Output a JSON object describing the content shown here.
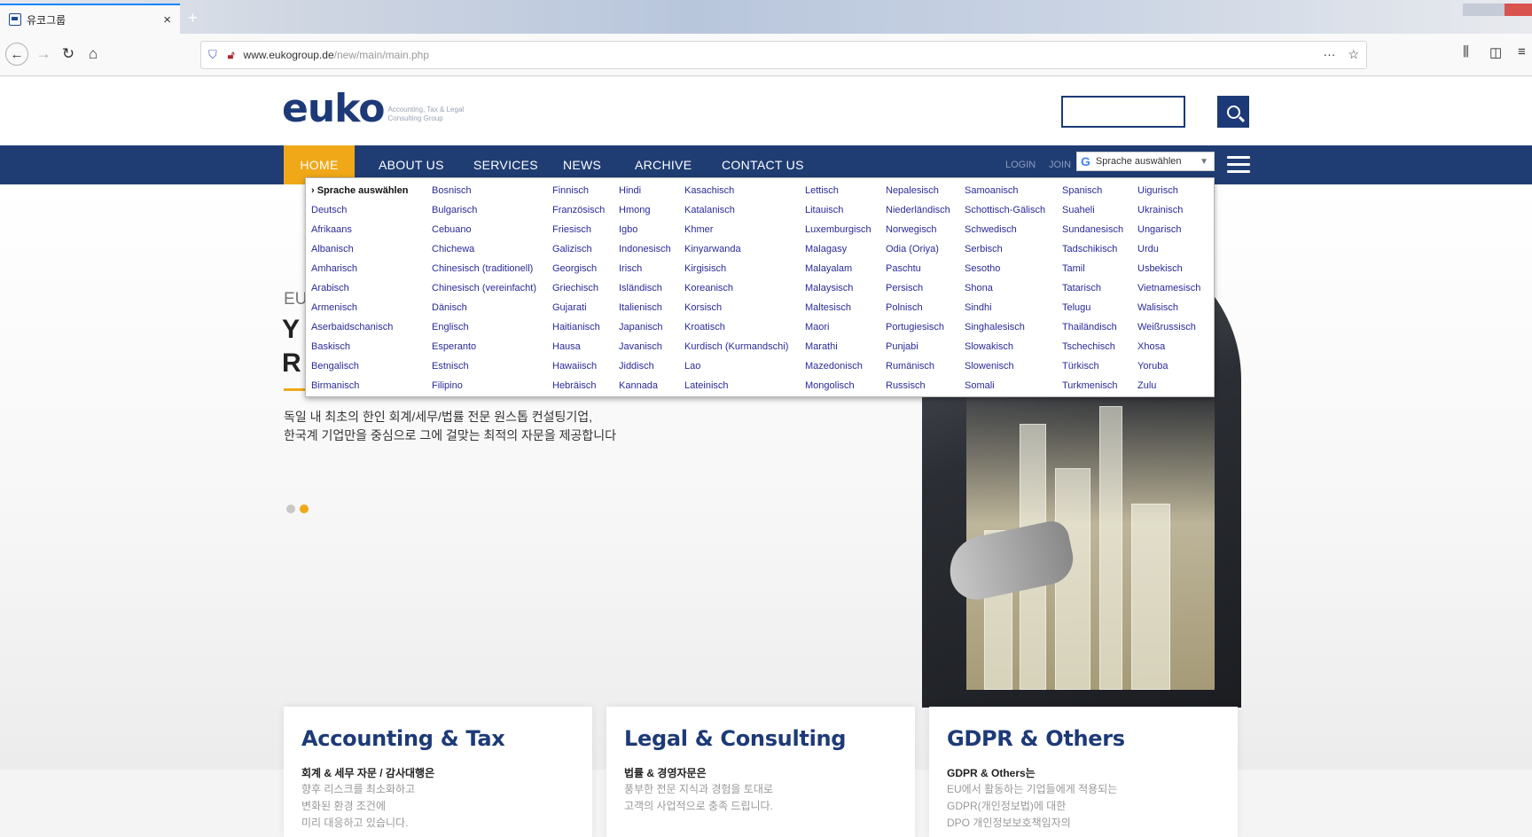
{
  "browser": {
    "tab_title": "유코그룹",
    "tab_close": "×",
    "new_tab": "+",
    "url_domain": "www.eukogroup.de",
    "url_path": "/new/main/main.php",
    "url_menu": "···",
    "bookmark_star": "☆",
    "nav_back": "←",
    "nav_forward": "→",
    "nav_reload": "↻",
    "nav_home": "⌂"
  },
  "site": {
    "logo_word": "euko",
    "logo_tagline": "Accounting, Tax & Legal Consulting Group",
    "search_placeholder": ""
  },
  "nav": {
    "items": [
      "HOME",
      "ABOUT US",
      "SERVICES",
      "NEWS",
      "ARCHIVE",
      "CONTACT US"
    ],
    "login": "LOGIN",
    "join": "JOIN",
    "translate_g": "G",
    "translate_label": "Sprache auswählen",
    "translate_arrow": "▼"
  },
  "hero": {
    "subtitle": "EU",
    "line1": "Y",
    "line2": "R",
    "desc_line1": "독일 내 최초의 한인 회계/세무/법률 전문 원스톱 컨설팅기업,",
    "desc_line2": "한국계 기업만을 중심으로 그에 걸맞는 최적의 자문을 제공합니다"
  },
  "language_menu": {
    "columns": [
      [
        "› Sprache auswählen",
        "Deutsch",
        "Afrikaans",
        "Albanisch",
        "Amharisch",
        "Arabisch",
        "Armenisch",
        "Aserbaidschanisch",
        "Baskisch",
        "Bengalisch",
        "Birmanisch"
      ],
      [
        "Bosnisch",
        "Bulgarisch",
        "Cebuano",
        "Chichewa",
        "Chinesisch (traditionell)",
        "Chinesisch (vereinfacht)",
        "Dänisch",
        "Englisch",
        "Esperanto",
        "Estnisch",
        "Filipino"
      ],
      [
        "Finnisch",
        "Französisch",
        "Friesisch",
        "Galizisch",
        "Georgisch",
        "Griechisch",
        "Gujarati",
        "Haitianisch",
        "Hausa",
        "Hawaiisch",
        "Hebräisch"
      ],
      [
        "Hindi",
        "Hmong",
        "Igbo",
        "Indonesisch",
        "Irisch",
        "Isländisch",
        "Italienisch",
        "Japanisch",
        "Javanisch",
        "Jiddisch",
        "Kannada"
      ],
      [
        "Kasachisch",
        "Katalanisch",
        "Khmer",
        "Kinyarwanda",
        "Kirgisisch",
        "Koreanisch",
        "Korsisch",
        "Kroatisch",
        "Kurdisch (Kurmandschi)",
        "Lao",
        "Lateinisch"
      ],
      [
        "Lettisch",
        "Litauisch",
        "Luxemburgisch",
        "Malagasy",
        "Malayalam",
        "Malaysisch",
        "Maltesisch",
        "Maori",
        "Marathi",
        "Mazedonisch",
        "Mongolisch"
      ],
      [
        "Nepalesisch",
        "Niederländisch",
        "Norwegisch",
        "Odia (Oriya)",
        "Paschtu",
        "Persisch",
        "Polnisch",
        "Portugiesisch",
        "Punjabi",
        "Rumänisch",
        "Russisch"
      ],
      [
        "Samoanisch",
        "Schottisch-Gälisch",
        "Schwedisch",
        "Serbisch",
        "Sesotho",
        "Shona",
        "Sindhi",
        "Singhalesisch",
        "Slowakisch",
        "Slowenisch",
        "Somali"
      ],
      [
        "Spanisch",
        "Suaheli",
        "Sundanesisch",
        "Tadschikisch",
        "Tamil",
        "Tatarisch",
        "Telugu",
        "Thailändisch",
        "Tschechisch",
        "Türkisch",
        "Turkmenisch"
      ],
      [
        "Uigurisch",
        "Ukrainisch",
        "Ungarisch",
        "Urdu",
        "Usbekisch",
        "Vietnamesisch",
        "Walisisch",
        "Weißrussisch",
        "Xhosa",
        "Yoruba",
        "Zulu"
      ]
    ]
  },
  "cards": [
    {
      "title": "Accounting & Tax",
      "lead": "회계 & 세무 자문 / 감사대행은",
      "body": [
        "향후 리스크를 최소화하고",
        "변화된 환경 조건에",
        "미리 대응하고 있습니다."
      ]
    },
    {
      "title": "Legal & Consulting",
      "lead": "법률 & 경영자문은",
      "body": [
        "풍부한 전문 지식과 경험을 토대로",
        "고객의 사업적으로 충족 드립니다."
      ]
    },
    {
      "title": "GDPR & Others",
      "lead": "GDPR & Others는",
      "body": [
        "EU에서 활동하는 기업들에게 적용되는",
        "GDPR(개인정보법)에 대한",
        "DPO 개인정보보호책임자의"
      ]
    }
  ],
  "colors": {
    "brand_navy": "#1f3d73",
    "accent_orange": "#f0a818",
    "link_blue": "#2a2a9a"
  }
}
